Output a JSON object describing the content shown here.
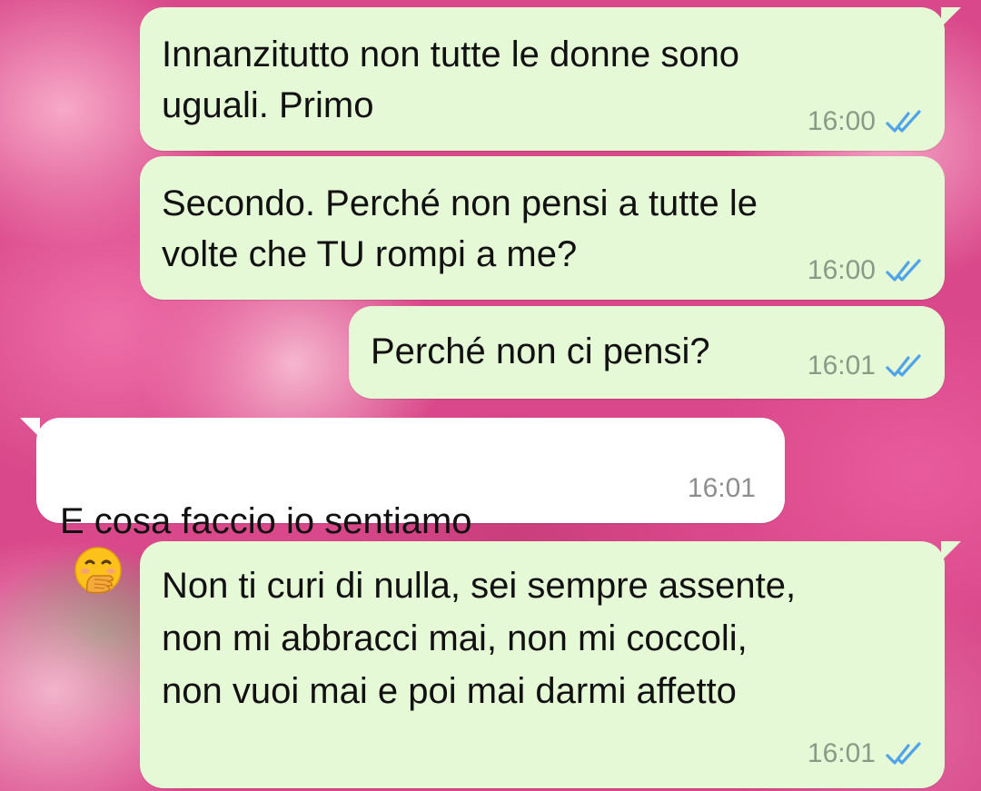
{
  "messages": [
    {
      "direction": "outgoing",
      "text": "Innanzitutto non tutte le donne sono\nuguali. Primo",
      "time": "16:00",
      "status_icon": "double-check-read-icon"
    },
    {
      "direction": "outgoing",
      "text": "Secondo. Perché non pensi a tutte le\nvolte che TU rompi a me?",
      "time": "16:00",
      "status_icon": "double-check-read-icon"
    },
    {
      "direction": "outgoing",
      "text": "Perché non ci pensi?",
      "time": "16:01",
      "status_icon": "double-check-read-icon"
    },
    {
      "direction": "incoming",
      "text": "E cosa faccio io sentiamo",
      "emoji": "face-with-hand-over-mouth-emoji",
      "time": "16:01"
    },
    {
      "direction": "outgoing",
      "text": "Non ti curi di nulla, sei sempre assente,\nnon mi abbracci mai, non mi coccoli,\nnon vuoi mai e poi mai darmi affetto",
      "time": "16:01",
      "status_icon": "double-check-read-icon"
    }
  ],
  "colors": {
    "outgoing_bubble": "#e6f9d6",
    "incoming_bubble": "#ffffff",
    "read_tick": "#4fa3e8",
    "timestamp": "#8a9a86"
  }
}
